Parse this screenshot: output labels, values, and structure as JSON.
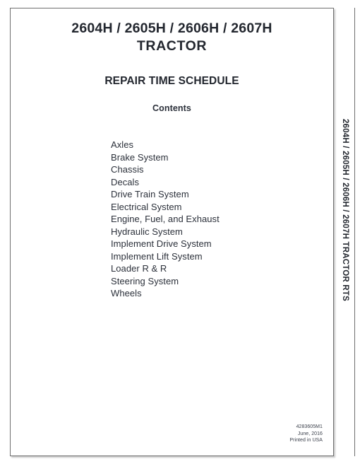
{
  "document": {
    "title": "2604H / 2605H / 2606H / 2607H",
    "subtitle": "TRACTOR",
    "section_title": "REPAIR TIME SCHEDULE",
    "contents_heading": "Contents"
  },
  "spine": {
    "label": "2604H / 2605H / 2606H / 2607H TRACTOR RTS"
  },
  "contents": {
    "items": [
      {
        "label": "Axles"
      },
      {
        "label": "Brake System"
      },
      {
        "label": "Chassis"
      },
      {
        "label": "Decals"
      },
      {
        "label": "Drive Train System"
      },
      {
        "label": "Electrical System"
      },
      {
        "label": "Engine, Fuel, and Exhaust"
      },
      {
        "label": "Hydraulic System"
      },
      {
        "label": "Implement Drive System"
      },
      {
        "label": "Implement Lift System"
      },
      {
        "label": "Loader R & R"
      },
      {
        "label": "Steering System"
      },
      {
        "label": "Wheels"
      }
    ]
  },
  "footer": {
    "part_number": "4283605M1",
    "date": "June, 2016",
    "printed": "Printed in USA"
  },
  "colors": {
    "text": "#2b303a",
    "title": "#23272f",
    "border": "#6f6f6f",
    "page": "#ffffff"
  }
}
